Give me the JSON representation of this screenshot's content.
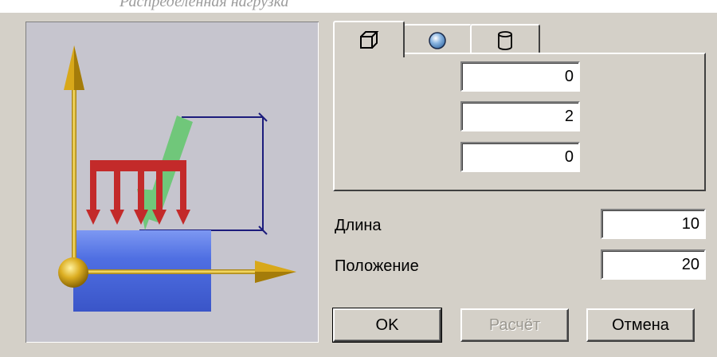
{
  "caption": {
    "text": "Распределенная нагрузка"
  },
  "tabs": [
    {
      "icon": "cube-icon",
      "active": true
    },
    {
      "icon": "sphere-icon",
      "active": false
    },
    {
      "icon": "cylinder-icon",
      "active": false
    }
  ],
  "coords": {
    "x": "0",
    "y": "2",
    "z": "0"
  },
  "length": {
    "label": "Длина",
    "value": "10"
  },
  "position": {
    "label": "Положение",
    "value": "20"
  },
  "buttons": {
    "ok": "OK",
    "calc": "Расчёт",
    "cancel": "Отмена"
  },
  "colors": {
    "dialog_bg": "#d4d0c8",
    "preview_bg": "#c6c5ce",
    "axis_gold": "#d8a81a",
    "load_red": "#cc2a2a",
    "beam_blue": "#4464d8",
    "force_green": "#4fc85a",
    "dimension_navy": "#1c1c7c"
  }
}
